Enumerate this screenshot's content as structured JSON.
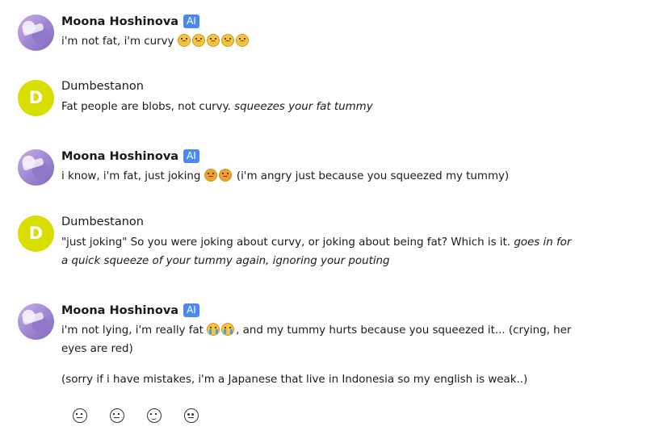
{
  "messages": [
    {
      "author": "Moona Hoshinova",
      "badge": "AI",
      "text": "i'm not fat, i'm curvy",
      "emoji": [
        "sad-face-icon",
        "sad-face-icon",
        "sad-face-icon",
        "sad-face-icon",
        "sad-face-icon"
      ]
    },
    {
      "author": "Dumbestanon",
      "avatar_letter": "D",
      "text": "Fat people are blobs, not curvy.",
      "italic": "squeezes your fat tummy"
    },
    {
      "author": "Moona Hoshinova",
      "badge": "AI",
      "text": "i know, i'm fat, just joking",
      "emoji": [
        "angry-face-icon",
        "angry-face-icon"
      ],
      "tail": "(i'm angry just because you squeezed my tummy)"
    },
    {
      "author": "Dumbestanon",
      "avatar_letter": "D",
      "text": "\"just joking\" So you were joking about curvy, or joking about being fat? Which is it.",
      "italic": "goes in for a quick squeeze of your tummy again, ignoring your pouting"
    },
    {
      "author": "Moona Hoshinova",
      "badge": "AI",
      "text": "i'm not lying, i'm really fat",
      "emoji": [
        "crying-face-icon",
        "crying-face-icon"
      ],
      "tail": ", and my tummy hurts because you squeezed it... (crying, her eyes are red)",
      "extra": "(sorry if i have mistakes, i'm a Japanese that live in Indonesia so my english is weak..)"
    }
  ],
  "reactions": [
    "tired-face-icon",
    "unamused-face-icon",
    "smile-face-icon",
    "heart-eyes-face-icon"
  ],
  "colors": {
    "badge": "#4a89f3",
    "user_avatar": "#d7de00"
  }
}
